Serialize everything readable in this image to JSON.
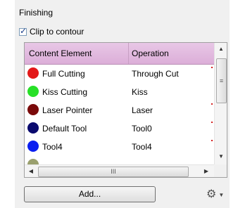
{
  "section": {
    "title": "Finishing"
  },
  "clip": {
    "label": "Clip to contour",
    "checked": true
  },
  "grid": {
    "headers": {
      "element": "Content Element",
      "operation": "Operation"
    },
    "rows": [
      {
        "element": "Full Cutting",
        "operation": "Through Cut",
        "color": "#e31818",
        "marked": true
      },
      {
        "element": "Kiss Cutting",
        "operation": "Kiss",
        "color": "#27e027",
        "marked": false
      },
      {
        "element": "Laser Pointer",
        "operation": "Laser",
        "color": "#7a0a0a",
        "marked": true
      },
      {
        "element": "Default Tool",
        "operation": "Tool0",
        "color": "#0a0a6e",
        "marked": true
      },
      {
        "element": "Tool4",
        "operation": "Tool4",
        "color": "#0a1ef0",
        "marked": true
      }
    ],
    "partial_row": {
      "color": "#9aa06e"
    }
  },
  "icons": {
    "checkmark": "✓",
    "arrow_up": "▲",
    "arrow_down": "▼",
    "arrow_left": "◀",
    "arrow_right": "▶",
    "grip_vertical": "≡",
    "grip_horizontal": "III",
    "gear": "⚙",
    "caret": "▼"
  },
  "actions": {
    "add_label": "Add..."
  }
}
